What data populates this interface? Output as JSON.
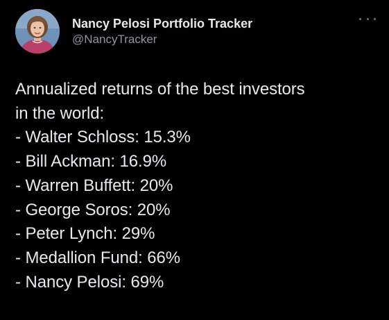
{
  "author": {
    "display_name": "Nancy Pelosi Portfolio Tracker",
    "handle": "@NancyTracker",
    "avatar_icon": "profile-photo"
  },
  "more_icon": "more-options-icon",
  "tweet": {
    "intro_line_1": "Annualized returns of the best investors",
    "intro_line_2": "in the world:",
    "items": [
      "- Walter Schloss: 15.3%",
      "- Bill Ackman: 16.9%",
      "- Warren Buffett: 20%",
      "- George Soros: 20%",
      "- Peter Lynch: 29%",
      "- Medallion Fund: 66%",
      "- Nancy Pelosi: 69%"
    ]
  },
  "colors": {
    "background": "#000000",
    "text_primary": "#e7e9ea",
    "text_secondary": "#8b98a5"
  }
}
